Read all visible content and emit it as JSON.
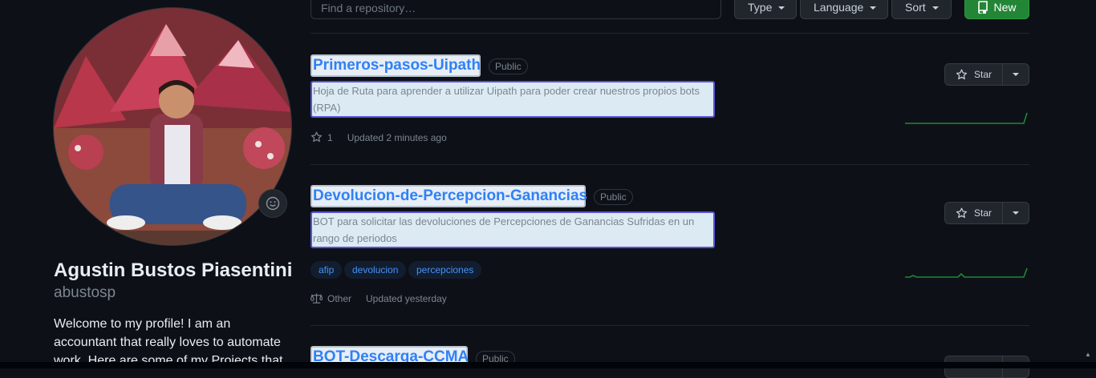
{
  "profile": {
    "full_name": "Agustin Bustos Piasentini",
    "username": "abustosp",
    "bio": "Welcome to my profile! I am an accountant that really loves to automate work. Here are some of my Projects that"
  },
  "toolbar": {
    "search_placeholder": "Find a repository…",
    "type_label": "Type",
    "language_label": "Language",
    "sort_label": "Sort",
    "new_label": "New"
  },
  "repos": [
    {
      "name": "Primeros-pasos-Uipath",
      "visibility": "Public",
      "description": "Hoja de Ruta para aprender a utilizar Uipath para poder crear nuestros propios bots (RPA)",
      "stars": "1",
      "updated": "Updated 2 minutes ago",
      "star_label": "Star"
    },
    {
      "name": "Devolucion-de-Percepcion-Ganancias",
      "visibility": "Public",
      "description": "BOT para solicitar las devoluciones de Percepciones de Ganancias Sufridas en un rango de periodos",
      "topics": [
        "afip",
        "devolucion",
        "percepciones"
      ],
      "license": "Other",
      "updated": "Updated yesterday",
      "star_label": "Star"
    },
    {
      "name": "BOT-Descarga-CCMA",
      "visibility": "Public"
    }
  ],
  "colors": {
    "background": "#0d1117",
    "link": "#2f81f7",
    "new_button": "#238636",
    "sparkline": "#238636"
  }
}
